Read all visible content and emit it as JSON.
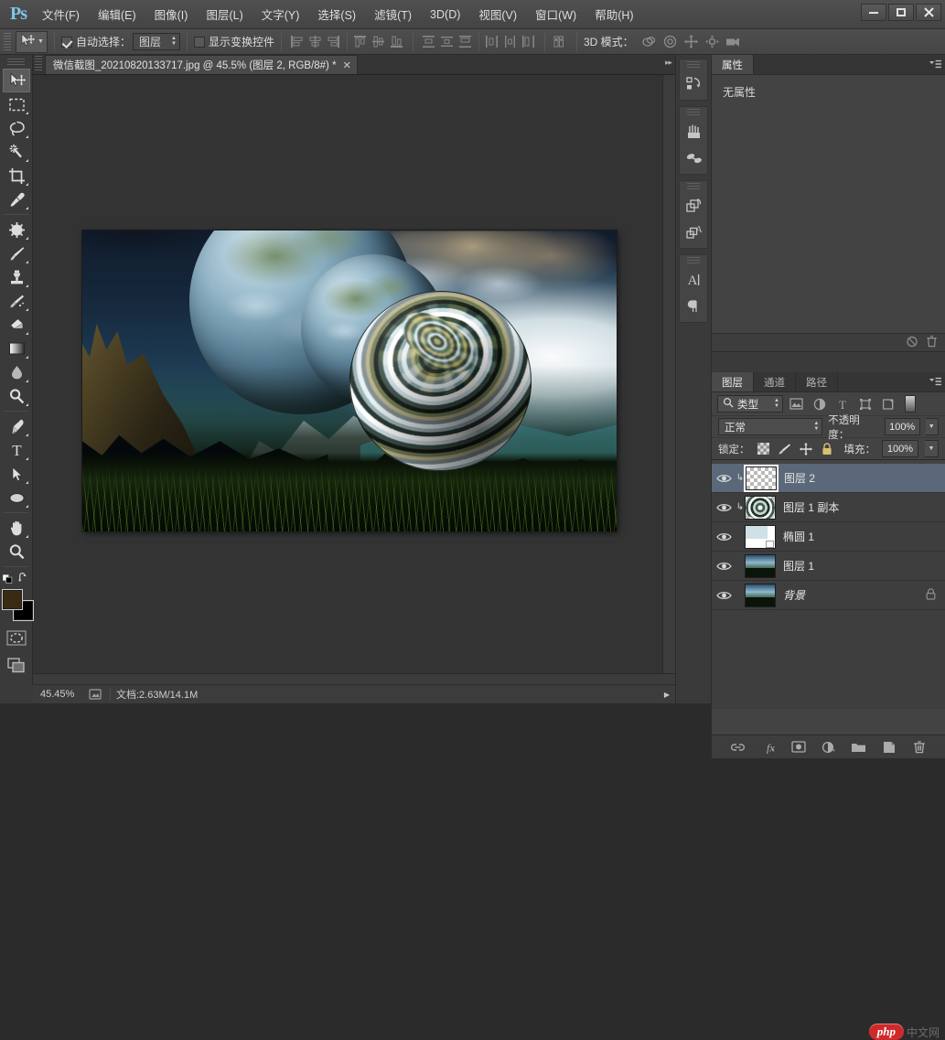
{
  "app": {
    "name": "Ps",
    "logo_text": "Ps"
  },
  "window_controls": {
    "minimize": "–",
    "maximize": "□",
    "close": "✕"
  },
  "menu": {
    "items": [
      {
        "label": "文件(F)"
      },
      {
        "label": "编辑(E)"
      },
      {
        "label": "图像(I)"
      },
      {
        "label": "图层(L)"
      },
      {
        "label": "文字(Y)"
      },
      {
        "label": "选择(S)"
      },
      {
        "label": "滤镜(T)"
      },
      {
        "label": "3D(D)"
      },
      {
        "label": "视图(V)"
      },
      {
        "label": "窗口(W)"
      },
      {
        "label": "帮助(H)"
      }
    ]
  },
  "options_bar": {
    "tool_preset_icon": "move-tool-icon",
    "auto_select_label": "自动选择：",
    "auto_select_checked": true,
    "auto_select_value": "图层",
    "show_transform_label": "显示变换控件",
    "show_transform_checked": false,
    "mode_3d_label": "3D 模式：",
    "align_icons": [
      "align-left-edges-icon",
      "align-horizontal-centers-icon",
      "align-right-edges-icon",
      "align-top-edges-icon",
      "align-vertical-centers-icon",
      "align-bottom-edges-icon"
    ],
    "distribute_icons": [
      "distribute-top-edges-icon",
      "distribute-vertical-centers-icon",
      "distribute-bottom-edges-icon",
      "distribute-left-edges-icon",
      "distribute-horizontal-centers-icon",
      "distribute-right-edges-icon"
    ],
    "auto_align_icon": "auto-align-layers-icon",
    "mode_3d_icons": [
      "orbit-3d-icon",
      "roll-3d-icon",
      "pan-3d-icon",
      "slide-3d-icon",
      "zoom-3d-camera-icon"
    ]
  },
  "document_tab": {
    "title": "微信截图_20210820133717.jpg @ 45.5% (图层 2, RGB/8#) *",
    "close_glyph": "✕"
  },
  "toolbar": {
    "tools": [
      {
        "name": "move-tool",
        "selected": true,
        "has_flyout": false
      },
      {
        "name": "rectangular-marquee-tool",
        "selected": false,
        "has_flyout": true
      },
      {
        "name": "lasso-tool",
        "selected": false,
        "has_flyout": true
      },
      {
        "name": "magic-wand-tool",
        "selected": false,
        "has_flyout": true
      },
      {
        "name": "crop-tool",
        "selected": false,
        "has_flyout": true
      },
      {
        "name": "eyedropper-tool",
        "selected": false,
        "has_flyout": true
      },
      {
        "name": "spot-healing-brush-tool",
        "selected": false,
        "has_flyout": true
      },
      {
        "name": "brush-tool",
        "selected": false,
        "has_flyout": true
      },
      {
        "name": "clone-stamp-tool",
        "selected": false,
        "has_flyout": true
      },
      {
        "name": "history-brush-tool",
        "selected": false,
        "has_flyout": true
      },
      {
        "name": "eraser-tool",
        "selected": false,
        "has_flyout": true
      },
      {
        "name": "gradient-tool",
        "selected": false,
        "has_flyout": true
      },
      {
        "name": "blur-tool",
        "selected": false,
        "has_flyout": true
      },
      {
        "name": "dodge-tool",
        "selected": false,
        "has_flyout": true
      },
      {
        "name": "pen-tool",
        "selected": false,
        "has_flyout": true
      },
      {
        "name": "horizontal-type-tool",
        "selected": false,
        "has_flyout": true
      },
      {
        "name": "path-selection-tool",
        "selected": false,
        "has_flyout": true
      },
      {
        "name": "ellipse-tool",
        "selected": false,
        "has_flyout": true
      },
      {
        "name": "hand-tool",
        "selected": false,
        "has_flyout": true
      },
      {
        "name": "zoom-tool",
        "selected": false,
        "has_flyout": false
      }
    ],
    "foreground_color": "#3b2a13",
    "background_color": "#000000",
    "swap_colors_icon": "swap-colors-icon",
    "default_colors_icon": "default-colors-icon",
    "quick_mask_icon": "quick-mask-mode-icon",
    "screen_mode_icon": "screen-mode-icon"
  },
  "icon_rail": {
    "groups": [
      {
        "icons": [
          "history-panel-icon"
        ]
      },
      {
        "icons": [
          "brush-presets-icon",
          "clone-source-icon"
        ]
      },
      {
        "icons": [
          "layer-comps-icon",
          "character-styles-icon"
        ]
      },
      {
        "icons": [
          "character-panel-icon",
          "paragraph-panel-icon"
        ]
      }
    ]
  },
  "properties_panel": {
    "tabs": [
      {
        "label": "属性",
        "active": true
      }
    ],
    "menu_icon": "panel-menu-icon",
    "empty_message": "无属性",
    "footer_icons": [
      "delete-adjustment-icon",
      "trash-icon"
    ]
  },
  "layers_panel": {
    "tabs": [
      {
        "label": "图层",
        "active": true
      },
      {
        "label": "通道",
        "active": false
      },
      {
        "label": "路径",
        "active": false
      }
    ],
    "menu_icon": "panel-menu-icon",
    "filter": {
      "search_icon": "search-icon",
      "kind_label": "类型",
      "filter_icons": [
        "filter-pixel-icon",
        "filter-adjustment-icon",
        "filter-type-icon",
        "filter-shape-icon",
        "filter-smart-object-icon"
      ],
      "toggle_icon": "filter-toggle-icon"
    },
    "blend_mode": "正常",
    "opacity_label": "不透明度：",
    "opacity_value": "100%",
    "lock_label": "锁定：",
    "lock_icons": [
      "lock-transparency-icon",
      "lock-image-icon",
      "lock-position-icon",
      "lock-all-icon"
    ],
    "fill_label": "填充：",
    "fill_value": "100%",
    "layers": [
      {
        "name": "图层 2",
        "visible": true,
        "selected": true,
        "clipped": true,
        "thumb": "checker",
        "locked": false,
        "italic": false
      },
      {
        "name": "图层 1 副本",
        "visible": true,
        "selected": false,
        "clipped": true,
        "thumb": "swirl",
        "locked": false,
        "italic": false
      },
      {
        "name": "椭圆 1",
        "visible": true,
        "selected": false,
        "clipped": false,
        "thumb": "shape-white",
        "locked": false,
        "italic": false
      },
      {
        "name": "图层 1",
        "visible": true,
        "selected": false,
        "clipped": false,
        "thumb": "photo",
        "locked": false,
        "italic": false
      },
      {
        "name": "背景",
        "visible": true,
        "selected": false,
        "clipped": false,
        "thumb": "photo",
        "locked": true,
        "italic": true
      }
    ],
    "footer_icons": [
      "link-layers-icon",
      "add-layer-style-icon",
      "add-layer-mask-icon",
      "new-adjustment-layer-icon",
      "new-group-icon",
      "new-layer-icon",
      "delete-layer-icon"
    ]
  },
  "status_bar": {
    "zoom": "45.45%",
    "preview_icon": "preview-box-icon",
    "doc_info": "文档:2.63M/14.1M",
    "arrow_glyph": "▶"
  },
  "watermark": {
    "brand": "php",
    "suffix": "中文网"
  },
  "canvas": {
    "artboard_alt": "fantasy-landscape-with-twirled-sphere"
  },
  "colors": {
    "accent_blue": "#7fc4e8",
    "selected_layer": "#5a6879",
    "panel_bg": "#434343",
    "toolbar_bg": "#3a3a3a",
    "canvas_bg": "#333333",
    "watermark_red": "#cf2a2a"
  }
}
